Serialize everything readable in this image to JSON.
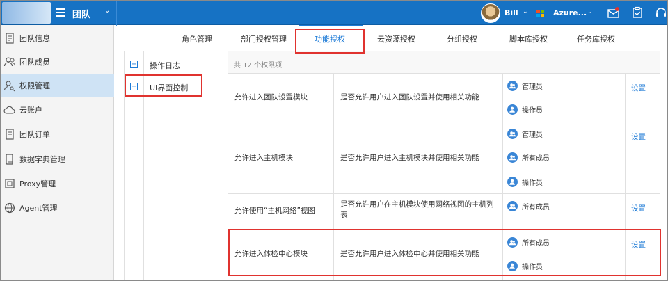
{
  "topbar": {
    "team_title": "团队",
    "user_name": "Bill",
    "tenant_name": "Azure...",
    "colors": {
      "bar": "#1672c4",
      "accent": "#1c7ad6",
      "highlight": "#e0332f"
    }
  },
  "sidebar": {
    "items": [
      {
        "label": "团队信息",
        "icon": "document-icon"
      },
      {
        "label": "团队成员",
        "icon": "users-icon"
      },
      {
        "label": "权限管理",
        "icon": "user-key-icon",
        "active": true
      },
      {
        "label": "云账户",
        "icon": "cloud-icon"
      },
      {
        "label": "团队订单",
        "icon": "order-icon"
      },
      {
        "label": "数据字典管理",
        "icon": "book-icon"
      },
      {
        "label": "Proxy管理",
        "icon": "proxy-icon"
      },
      {
        "label": "Agent管理",
        "icon": "globe-icon"
      }
    ]
  },
  "tabs": [
    {
      "label": "角色管理"
    },
    {
      "label": "部门授权管理"
    },
    {
      "label": "功能授权",
      "active": true
    },
    {
      "label": "云资源授权"
    },
    {
      "label": "分组授权"
    },
    {
      "label": "脚本库授权"
    },
    {
      "label": "任务库授权"
    }
  ],
  "tree": [
    {
      "label": "操作日志",
      "toggle": "+"
    },
    {
      "label": "UI界面控制",
      "toggle": "−",
      "selected": true
    }
  ],
  "permissions": {
    "count_text": "共 12 个权限项",
    "action_label": "设置",
    "rows": [
      {
        "name": "允许进入团队设置模块",
        "desc": "是否允许用户进入团队设置并使用相关功能",
        "roles": [
          "管理员",
          "操作员"
        ]
      },
      {
        "name": "允许进入主机模块",
        "desc": "是否允许用户进入主机模块并使用相关功能",
        "roles": [
          "管理员",
          "所有成员",
          "操作员"
        ]
      },
      {
        "name": "允许使用“主机网络”视图",
        "desc": "是否允许用户在主机模块使用网络视图的主机列表",
        "roles": [
          "所有成员"
        ]
      },
      {
        "name": "允许进入体检中心模块",
        "desc": "是否允许用户进入体检中心并使用相关功能",
        "roles": [
          "所有成员",
          "操作员"
        ]
      }
    ]
  }
}
